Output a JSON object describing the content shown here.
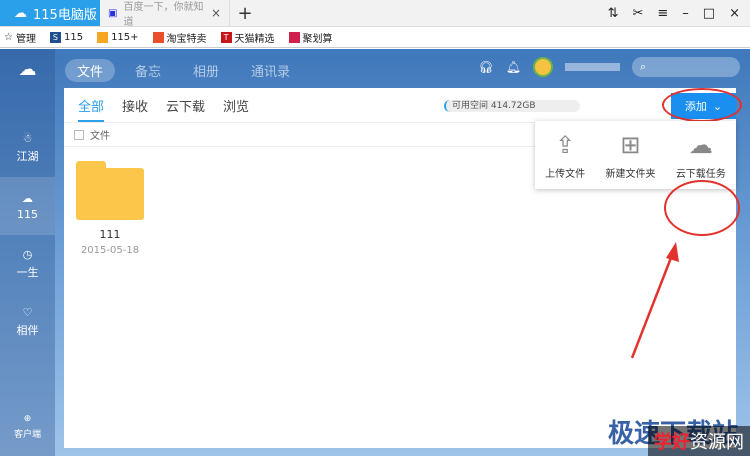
{
  "tabs": [
    {
      "label": "115电脑版",
      "active": true
    },
    {
      "label": "百度一下，你就知道"
    }
  ],
  "bookmarks": [
    {
      "label": "管理"
    },
    {
      "label": "115",
      "color": "#1f4f8c"
    },
    {
      "label": "115+",
      "color": "#f5a623"
    },
    {
      "label": "淘宝特卖",
      "color": "#e8502a"
    },
    {
      "label": "天猫精选",
      "color": "#c4161c"
    },
    {
      "label": "聚划算",
      "color": "#d0214e"
    }
  ],
  "sidebar": {
    "items": [
      {
        "label": "江湖",
        "icon": "ghost-icon"
      },
      {
        "label": "115",
        "icon": "cloud-icon",
        "active": true
      },
      {
        "label": "一生",
        "icon": "clock-icon"
      },
      {
        "label": "相伴",
        "icon": "heart-icon"
      }
    ],
    "bottom": "客户端"
  },
  "topnav": [
    {
      "label": "文件",
      "active": true
    },
    {
      "label": "备忘"
    },
    {
      "label": "相册"
    },
    {
      "label": "通讯录"
    }
  ],
  "subtabs": [
    {
      "label": "全部",
      "active": true
    },
    {
      "label": "接收"
    },
    {
      "label": "云下载"
    },
    {
      "label": "浏览"
    }
  ],
  "space": "可用空间 414.72GB",
  "add_label": "添加",
  "header_label": "文件",
  "folder": {
    "name": "111",
    "date": "2015-05-18"
  },
  "menu": [
    {
      "label": "上传文件",
      "icon": "upload-icon"
    },
    {
      "label": "新建文件夹",
      "icon": "new-folder-icon"
    },
    {
      "label": "云下载任务",
      "icon": "cloud-download-icon"
    }
  ],
  "watermark": {
    "main": "极速下载站",
    "sub_a": "学好",
    "sub_b": "资源网"
  },
  "accent": "#2aa0ea"
}
